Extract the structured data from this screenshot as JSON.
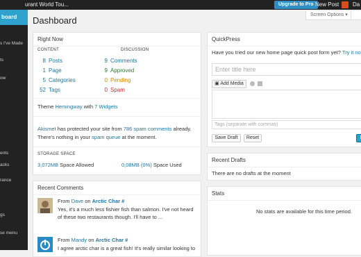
{
  "adminbar": {
    "site": "urant World Tou...",
    "upgrade": "Upgrade to Pro",
    "new_post": "New Post",
    "user": "Da"
  },
  "sidebar": {
    "active": "board",
    "items": [
      "s I've Made",
      "ts",
      "ow",
      "ents",
      "acks",
      "rance",
      "gs",
      "se menu"
    ]
  },
  "header": {
    "title": "Dashboard",
    "screen_options": "Screen Options ▾"
  },
  "right_now": {
    "title": "Right Now",
    "content_label": "CONTENT",
    "discussion_label": "DISCUSSION",
    "content": [
      {
        "count": "8",
        "label": "Posts"
      },
      {
        "count": "1",
        "label": "Page"
      },
      {
        "count": "5",
        "label": "Categories"
      },
      {
        "count": "52",
        "label": "Tags"
      }
    ],
    "discussion": [
      {
        "count": "9",
        "label": "Comments"
      },
      {
        "count": "9",
        "label": "Approved"
      },
      {
        "count": "0",
        "label": "Pending"
      },
      {
        "count": "0",
        "label": "Spam"
      }
    ],
    "theme_prefix": "Theme ",
    "theme_name": "Hemingway",
    "theme_with": " with ",
    "widgets": "7 Widgets",
    "akismet": "Akismet",
    "akismet_mid": " has protected your site from ",
    "spam_count": "786 spam comments",
    "akismet_end": " already.",
    "akismet_line2a": "There's nothing in your ",
    "spam_queue": "spam queue",
    "akismet_line2b": " at the moment.",
    "storage_label": "STORAGE SPACE",
    "allowed": "3,072MB",
    "allowed_label": " Space Allowed",
    "used": "0,08MB (0%)",
    "used_label": " Space Used"
  },
  "recent_comments": {
    "title": "Recent Comments",
    "items": [
      {
        "from": "From ",
        "author": "Dave",
        "on": " on ",
        "post": "Arctic Char #",
        "text1": "Yes, it's a much less fishier fish than salmon. I've not heard",
        "text2": "of these two restaurants though. I'll have to ..."
      },
      {
        "from": "From ",
        "author": "Mandy",
        "on": " on ",
        "post": "Arctic Char #",
        "text1": "I agree arctic char is a great fish! It's really similar looking to",
        "text2": ""
      }
    ]
  },
  "quickpress": {
    "title": "QuickPress",
    "notice": "Have you tried our new home page quick post form yet?",
    "notice_link": "Try it now",
    "title_placeholder": "Enter title here",
    "add_media": "Add Media",
    "tags_placeholder": "Tags (separate with commas)",
    "save_draft": "Save Draft",
    "reset": "Reset",
    "publish": "Pu"
  },
  "recent_drafts": {
    "title": "Recent Drafts",
    "text": "There are no drafts at the moment"
  },
  "stats": {
    "title": "Stats",
    "text": "No stats are available for this time period."
  },
  "colors": {
    "accent": "#2ea2cc",
    "link": "#21759b",
    "adminbar": "#222222"
  }
}
